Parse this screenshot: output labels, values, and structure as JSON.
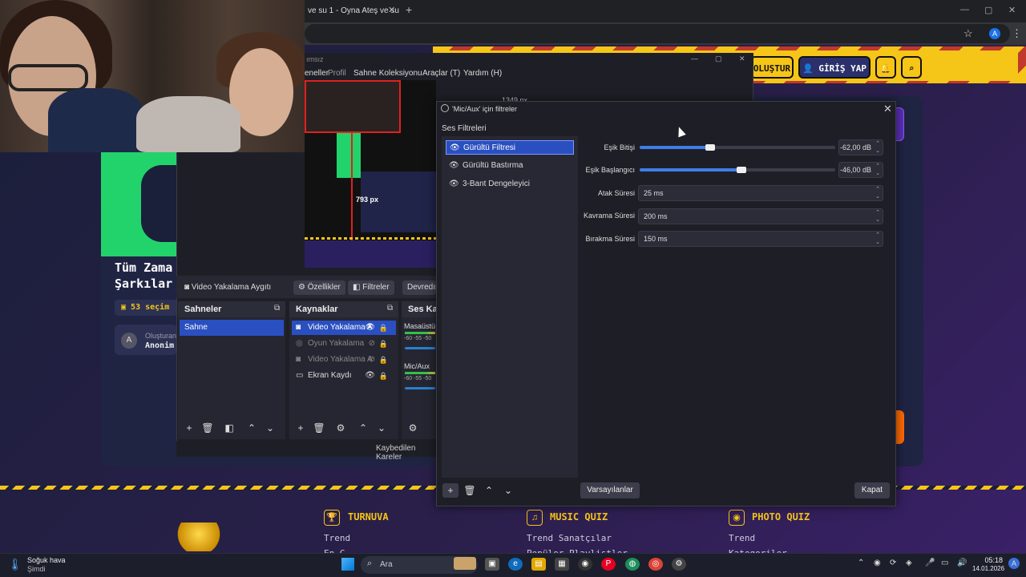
{
  "browser": {
    "tab_title": "ve su 1 - Oyna Ateş ve su",
    "tab_close": "✕",
    "new_tab": "+",
    "minimize": "—",
    "maximize": "▢",
    "close": "✕",
    "star_icon": "☆",
    "profile_initial": "A",
    "menu_icon": "⋮"
  },
  "site": {
    "create_button": "OLUŞTUR",
    "login_button": "GİRİŞ YAP",
    "title_line1": "Tüm Zama",
    "title_line2": "Şarkılar",
    "selection_count": "53 seçim",
    "creator_label": "Oluşturan",
    "creator_name": "Anonim",
    "creator_initial": "A",
    "footer": [
      {
        "heading": "TURNUVA",
        "icon": "trophy-icon",
        "glyph": "🏆",
        "items": [
          "Trend",
          "En G"
        ]
      },
      {
        "heading": "MUSIC QUIZ",
        "icon": "music-icon",
        "glyph": "♫",
        "items": [
          "Trend Sanatçılar",
          "Popüler Playlistler"
        ]
      },
      {
        "heading": "PHOTO QUIZ",
        "icon": "camera-icon",
        "glyph": "◉",
        "items": [
          "Trend",
          "Kategoriler"
        ]
      }
    ]
  },
  "obs": {
    "window_title": "ımsız",
    "menu": [
      "eneller",
      "Profil",
      "Sahne Koleksiyonu",
      "Araçlar (T)",
      "Yardım (H)"
    ],
    "preview_px_label": "793 px",
    "preview_px_label2": "1349 px",
    "source_toolbar": {
      "source_name": "Video Yakalama Aygıtı",
      "properties": "Özellikler",
      "filters": "Filtreler",
      "deactivate": "Devredışı"
    },
    "docks": {
      "scenes": "Sahneler",
      "sources": "Kaynaklar",
      "mixer": "Ses Karı"
    },
    "scenes": [
      "Sahne"
    ],
    "sources": [
      {
        "name": "Video Yakalama A",
        "icon": "camera-icon",
        "state": "sel"
      },
      {
        "name": "Oyun Yakalama",
        "icon": "gamepad-icon",
        "state": "dim"
      },
      {
        "name": "Video Yakalama A",
        "icon": "camera-icon",
        "state": "dim"
      },
      {
        "name": "Ekran Kaydı",
        "icon": "monitor-icon",
        "state": "normal"
      }
    ],
    "mixer": [
      {
        "name": "Masaüstü"
      },
      {
        "name": "Mic/Aux"
      }
    ],
    "meter_scale": "-60  -55  -50",
    "status": "Kaybedilen Kareler"
  },
  "dialog": {
    "title": "'Mic/Aux' için filtreler",
    "section": "Ses Filtreleri",
    "filters": [
      "Gürültü Filtresi",
      "Gürültü Bastırma",
      "3-Bant Dengeleyici"
    ],
    "selected_filter": 0,
    "properties": {
      "close_threshold_label": "Eşik Bitişi",
      "close_threshold_value": "-62,00 dB",
      "close_threshold_fraction": 0.36,
      "open_threshold_label": "Eşik Başlangıcı",
      "open_threshold_value": "-46,00 dB",
      "open_threshold_fraction": 0.52,
      "attack_label": "Atak Süresi",
      "attack_value": "25 ms",
      "hold_label": "Kavrama Süresi",
      "hold_value": "200 ms",
      "release_label": "Bırakma Süresi",
      "release_value": "150 ms"
    },
    "defaults_button": "Varsayılanlar",
    "close_button": "Kapat"
  },
  "taskbar": {
    "weather_title": "Soğuk hava",
    "weather_sub": "Şimdi",
    "search_placeholder": "Ara",
    "time": "05:18",
    "date": "14.01.2026",
    "tray_lang": "A"
  }
}
